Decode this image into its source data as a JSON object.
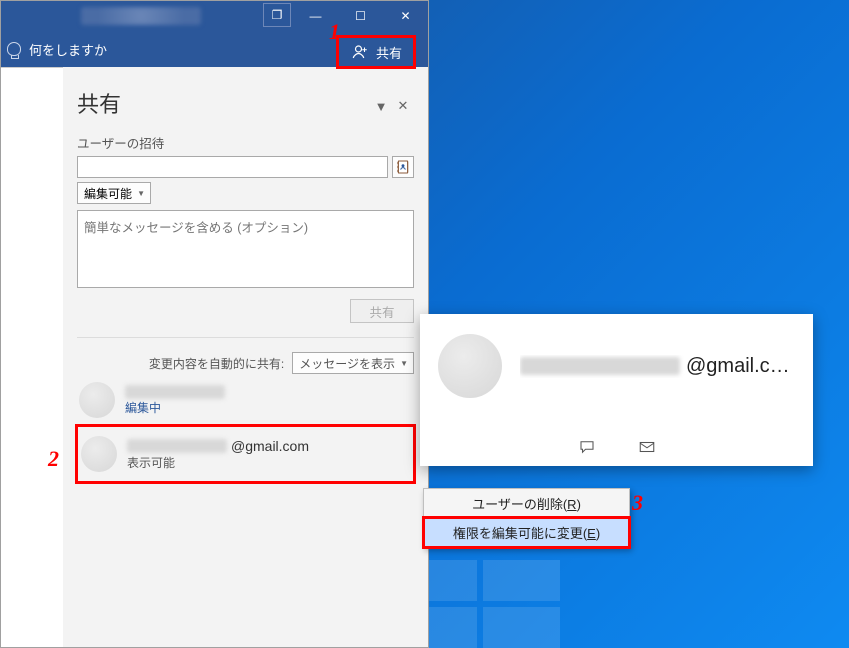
{
  "annotations": {
    "one": "1",
    "two": "2",
    "three": "3"
  },
  "titlebar": {
    "restore_label": "❐",
    "minimize_label": "—",
    "maximize_label": "☐",
    "close_label": "✕"
  },
  "ribbon": {
    "tell_me": "何をしますか",
    "share_label": "共有"
  },
  "share_pane": {
    "title": "共有",
    "dropdown_glyph": "▼",
    "close_glyph": "✕",
    "invite_label": "ユーザーの招待",
    "invite_value": "",
    "permission_selected": "編集可能",
    "message_placeholder": "簡単なメッセージを含める (オプション)",
    "share_button": "共有",
    "auto_share_label": "変更内容を自動的に共有:",
    "auto_share_selected": "メッセージを表示",
    "users": [
      {
        "status": "編集中",
        "status_kind": "link"
      },
      {
        "email": "@gmail.com",
        "status": "表示可能",
        "status_kind": "plain"
      }
    ]
  },
  "contact_card": {
    "email_suffix": "@gmail.c…"
  },
  "context_menu": {
    "items": [
      {
        "label_pre": "ユーザーの削除(",
        "mn": "R",
        "label_post": ")",
        "hover": false
      },
      {
        "label_pre": "権限を編集可能に変更(",
        "mn": "E",
        "label_post": ")",
        "hover": true
      }
    ]
  }
}
